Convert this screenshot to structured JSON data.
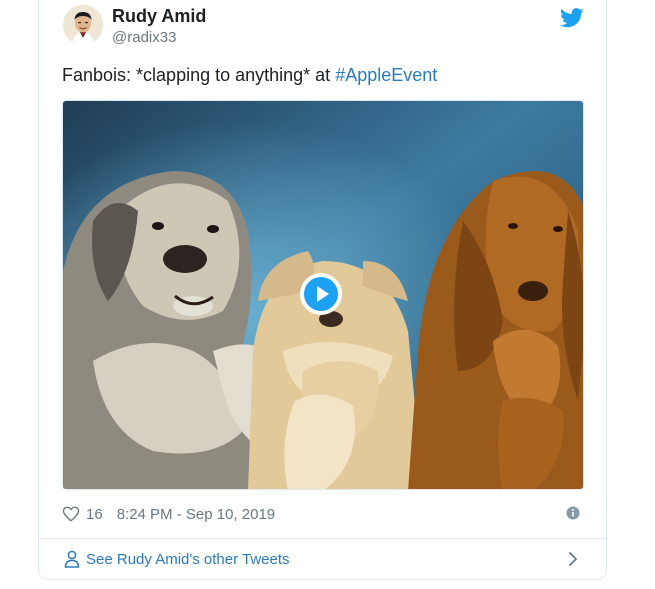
{
  "author": {
    "name": "Rudy Amid",
    "handle": "@radix33"
  },
  "tweet": {
    "text_prefix": "Fanbois: *clapping to anything* at ",
    "hashtag": "#AppleEvent"
  },
  "footer": {
    "like_count": "16",
    "timestamp": "8:24 PM - Sep 10, 2019",
    "other_tweets_label": "See Rudy Amid's other Tweets"
  },
  "colors": {
    "link": "#2b7bb9",
    "twitter_blue": "#1da1f2",
    "secondary_text": "#697882"
  },
  "icons": {
    "bird": "twitter-bird-icon",
    "play": "play-icon",
    "heart": "heart-icon",
    "info": "info-icon",
    "person": "person-icon",
    "chevron": "chevron-right-icon"
  }
}
